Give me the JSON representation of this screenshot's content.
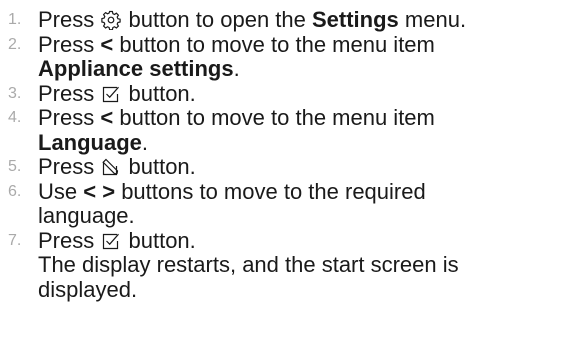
{
  "steps": [
    {
      "number": "1.",
      "parts": {
        "a": "Press",
        "icon": "gear-icon",
        "b": "button to open the",
        "bold": "Settings",
        "c": "menu."
      }
    },
    {
      "number": "2.",
      "parts": {
        "a": "Press",
        "key": "<",
        "b": "button to move to the menu item",
        "bold": "Appliance settings",
        "c": "."
      }
    },
    {
      "number": "3.",
      "parts": {
        "a": "Press",
        "icon": "confirm-check-icon",
        "b": "button."
      }
    },
    {
      "number": "4.",
      "parts": {
        "a": "Press",
        "key": "<",
        "b": "button to move to the menu item",
        "bold": "Language",
        "c": "."
      }
    },
    {
      "number": "5.",
      "parts": {
        "a": "Press",
        "icon": "edit-icon",
        "b": "button."
      }
    },
    {
      "number": "6.",
      "parts": {
        "a": "Use",
        "keys": "< >",
        "b": "buttons to move to the required",
        "c": "language."
      }
    },
    {
      "number": "7.",
      "parts": {
        "a": "Press",
        "icon": "confirm-check-icon",
        "b": "button.",
        "result_line1": "The display restarts, and the start screen is",
        "result_line2": "displayed."
      }
    }
  ]
}
